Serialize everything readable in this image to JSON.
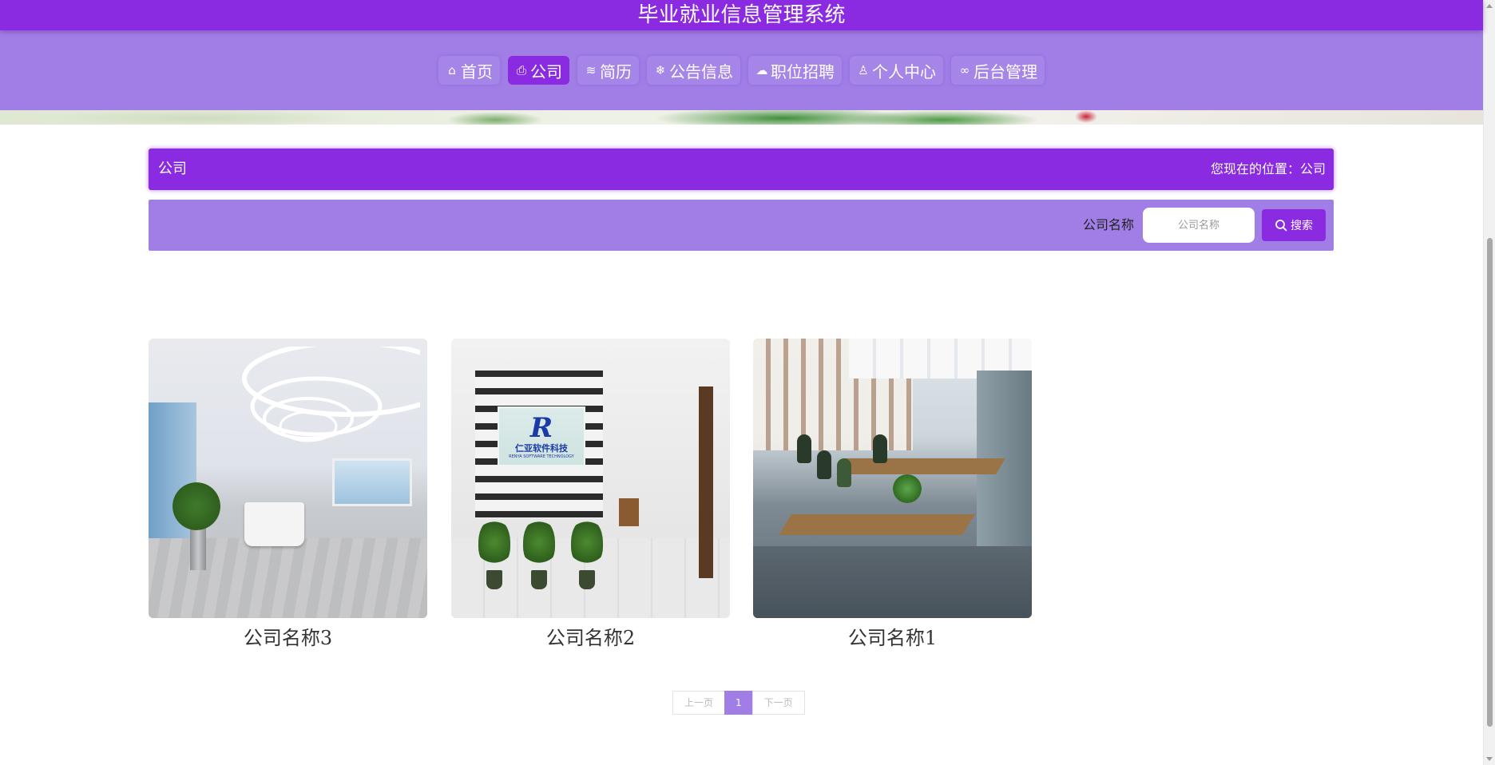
{
  "header": {
    "title": "毕业就业信息管理系统"
  },
  "nav": {
    "items": [
      {
        "label": "首页",
        "icon": "home-icon",
        "glyph": "⌂",
        "active": false
      },
      {
        "label": "公司",
        "icon": "printer-icon",
        "glyph": "⎙",
        "active": true
      },
      {
        "label": "简历",
        "icon": "layers-icon",
        "glyph": "≋",
        "active": false
      },
      {
        "label": "公告信息",
        "icon": "snowflake-icon",
        "glyph": "❄",
        "active": false
      },
      {
        "label": "职位招聘",
        "icon": "cloud-icon",
        "glyph": "☁",
        "active": false
      },
      {
        "label": "个人中心",
        "icon": "user-icon",
        "glyph": "♙",
        "active": false
      },
      {
        "label": "后台管理",
        "icon": "link-icon",
        "glyph": "∞",
        "active": false
      }
    ]
  },
  "breadcrumb": {
    "title": "公司",
    "location": "您现在的位置：公司"
  },
  "search": {
    "label": "公司名称",
    "placeholder": "公司名称",
    "value": "",
    "button_label": "搜索"
  },
  "companies": [
    {
      "name": "公司名称3"
    },
    {
      "name": "公司名称2"
    },
    {
      "name": "公司名称1"
    }
  ],
  "company_photo_text": {
    "logo_letter": "R",
    "logo_cn": "仁亚软件科技",
    "logo_en": "RENYA SOFTWARE TECHNOLOGY"
  },
  "pagination": {
    "prev_label": "上一页",
    "current_page": "1",
    "next_label": "下一页"
  },
  "colors": {
    "primary": "#8a2be2",
    "secondary": "#a07ee6"
  }
}
